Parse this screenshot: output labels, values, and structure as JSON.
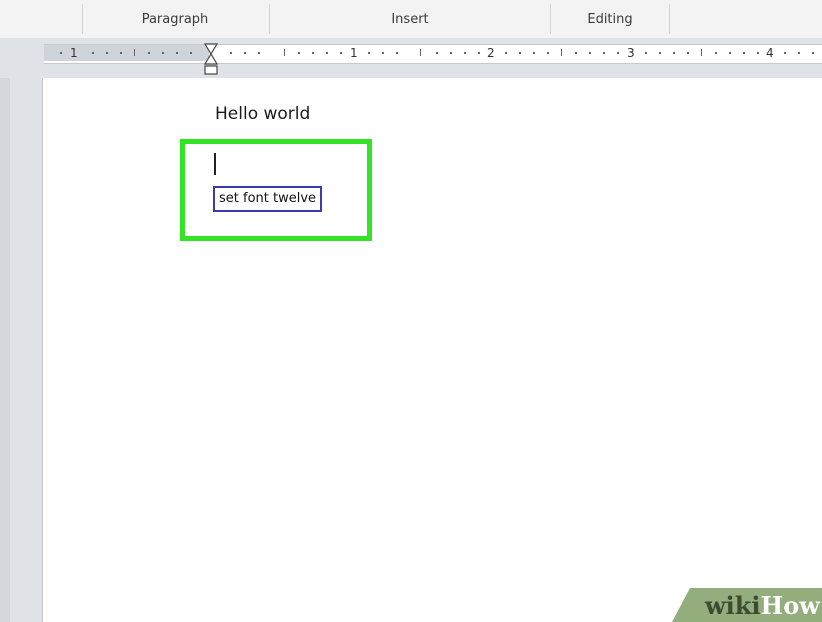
{
  "ribbon": {
    "groups": [
      {
        "label": "Paragraph"
      },
      {
        "label": "Insert"
      },
      {
        "label": "Editing"
      }
    ]
  },
  "ruler": {
    "numbers": [
      "1",
      "1",
      "2",
      "3",
      "4"
    ]
  },
  "document": {
    "lines": [
      "Hello world"
    ],
    "speech_tip": "set font twelve"
  },
  "watermark": {
    "wiki": "wiki",
    "how": "How"
  },
  "colors": {
    "highlight": "#33e326",
    "tip_border": "#3b3bb0",
    "watermark_bg": "#93ad7c"
  },
  "icons": {
    "indent_marker": "hourglass-indent-icon"
  }
}
